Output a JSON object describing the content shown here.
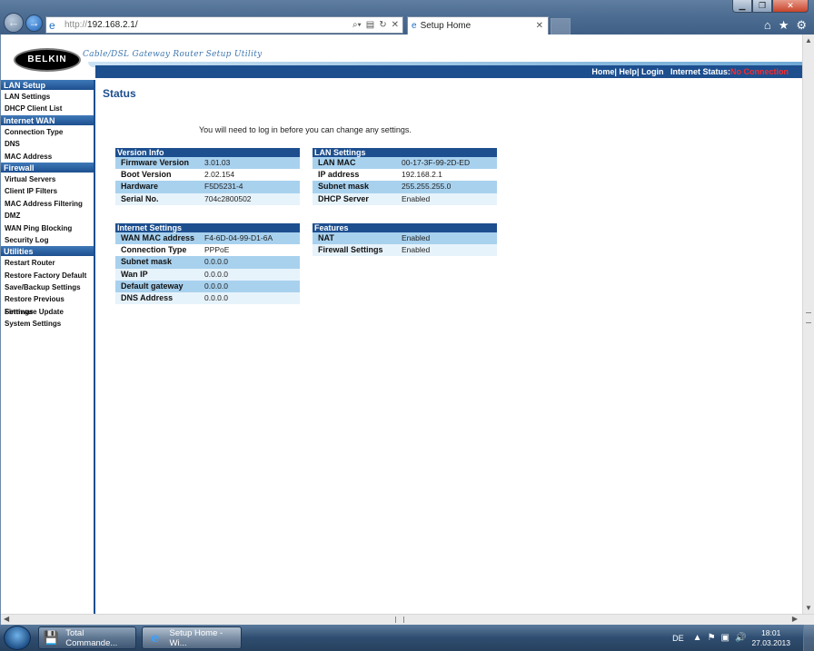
{
  "browser": {
    "url_prefix": "http://",
    "url_host": "192.168.2.1/",
    "tab_title": "Setup Home",
    "window_controls": [
      "minimize-icon",
      "maximize-icon",
      "close-icon"
    ]
  },
  "header": {
    "logo": "BELKIN",
    "subtitle": "Cable/DSL Gateway Router Setup Utility",
    "links": {
      "home": "Home",
      "help": "Help",
      "login": "Login"
    },
    "status_label": "Internet Status:",
    "status_value": "No Connection",
    "status_color": "#ff2a2a"
  },
  "sidebar": {
    "sections": [
      {
        "title": "LAN Setup",
        "items": [
          "LAN Settings",
          "DHCP Client List"
        ]
      },
      {
        "title": "Internet WAN",
        "items": [
          "Connection Type",
          "DNS",
          "MAC Address"
        ]
      },
      {
        "title": "Firewall",
        "items": [
          "Virtual Servers",
          "Client IP Filters",
          "MAC Address Filtering",
          "DMZ",
          "WAN Ping Blocking",
          "Security Log"
        ]
      },
      {
        "title": "Utilities",
        "items": [
          "Restart Router",
          "Restore Factory Default",
          "Save/Backup Settings",
          "Restore Previous Settings",
          "Firmware Update",
          "System Settings"
        ]
      }
    ]
  },
  "main": {
    "title": "Status",
    "notice": "You will need to log in before you can change any settings.",
    "version_info": {
      "title": "Version Info",
      "rows": [
        {
          "k": "Firmware Version",
          "v": "3.01.03"
        },
        {
          "k": "Boot Version",
          "v": "2.02.154"
        },
        {
          "k": "Hardware",
          "v": "F5D5231-4"
        },
        {
          "k": "Serial No.",
          "v": "704c2800502"
        }
      ]
    },
    "lan_settings": {
      "title": "LAN Settings",
      "rows": [
        {
          "k": "LAN MAC",
          "v": "00-17-3F-99-2D-ED"
        },
        {
          "k": "IP address",
          "v": "192.168.2.1"
        },
        {
          "k": "Subnet mask",
          "v": "255.255.255.0"
        },
        {
          "k": "DHCP Server",
          "v": "Enabled"
        }
      ]
    },
    "internet_settings": {
      "title": "Internet Settings",
      "rows": [
        {
          "k": "WAN MAC address",
          "v": "F4-6D-04-99-D1-6A"
        },
        {
          "k": "Connection Type",
          "v": "PPPoE"
        },
        {
          "k": "Subnet mask",
          "v": "0.0.0.0"
        },
        {
          "k": "Wan IP",
          "v": "0.0.0.0"
        },
        {
          "k": "Default gateway",
          "v": "0.0.0.0"
        },
        {
          "k": "DNS Address",
          "v": "0.0.0.0"
        }
      ]
    },
    "features": {
      "title": "Features",
      "rows": [
        {
          "k": "NAT",
          "v": "Enabled"
        },
        {
          "k": "Firewall Settings",
          "v": "Enabled"
        }
      ]
    }
  },
  "taskbar": {
    "buttons": [
      {
        "label": "Total Commande...",
        "icon": "floppy-disk-icon"
      },
      {
        "label": "Setup Home - Wi...",
        "icon": "internet-explorer-icon"
      }
    ],
    "language": "DE",
    "time": "18:01",
    "date": "27.03.2013"
  }
}
